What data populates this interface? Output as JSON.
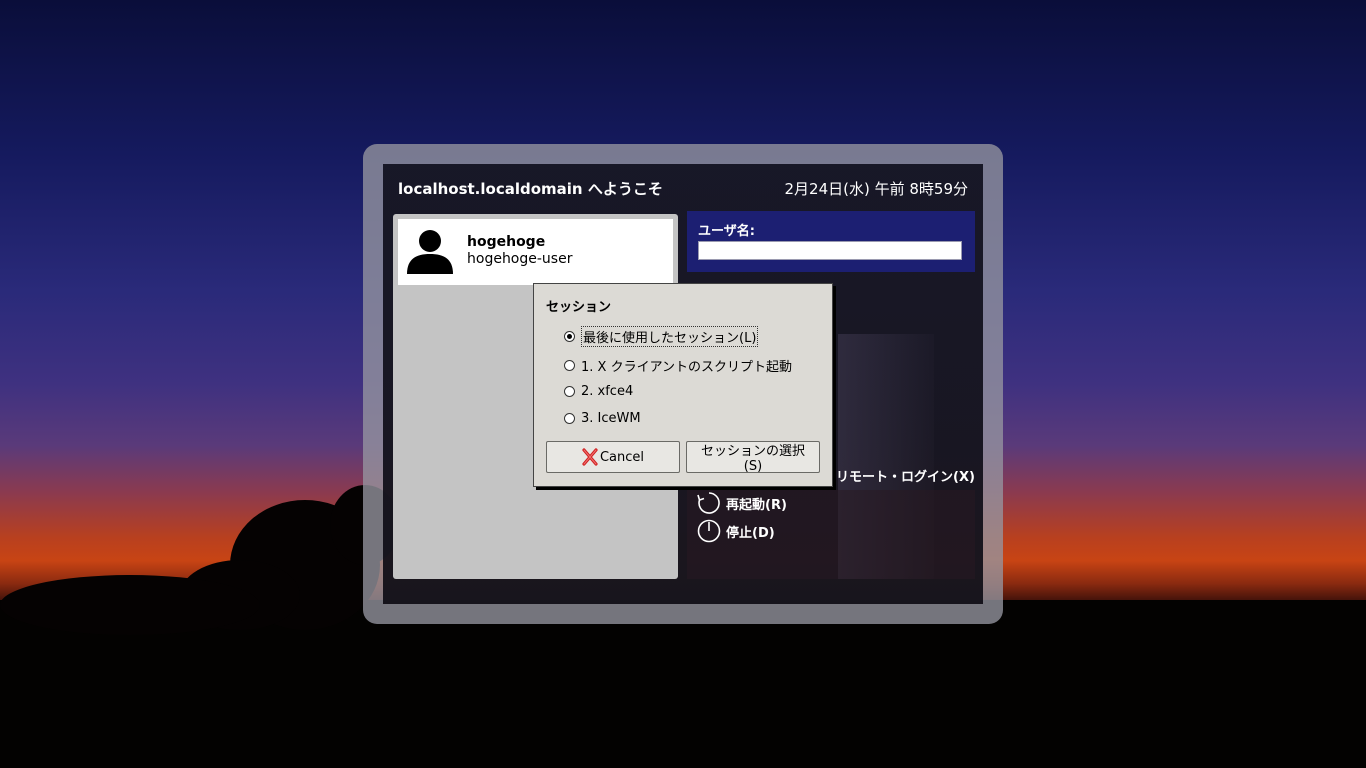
{
  "greeter": {
    "welcome": "localhost.localdomain へようこそ",
    "clock": "2月24日(水) 午前 8時59分"
  },
  "user_list": [
    {
      "username": "hogehoge",
      "fullname": "hogehoge-user"
    }
  ],
  "login": {
    "username_label": "ユーザ名:",
    "username_value": ""
  },
  "actions": {
    "remote_login": "リモート・ログイン(X)",
    "restart": "再起動(R)",
    "halt": "停止(D)"
  },
  "session_dialog": {
    "title": "セッション",
    "options": [
      {
        "label": "最後に使用したセッション(L)",
        "selected": true
      },
      {
        "label": "1. X クライアントのスクリプト起動",
        "selected": false
      },
      {
        "label": "2. xfce4",
        "selected": false
      },
      {
        "label": "3. IceWM",
        "selected": false
      }
    ],
    "cancel_label": "Cancel",
    "select_label": "セッションの選択(S)"
  },
  "colors": {
    "login_box": "#1c1f72",
    "dialog_bg": "#dcdad5",
    "cancel_icon": "#d02020"
  },
  "icons": [
    "user-avatar-icon",
    "restart-icon",
    "power-icon",
    "cancel-x-icon"
  ]
}
